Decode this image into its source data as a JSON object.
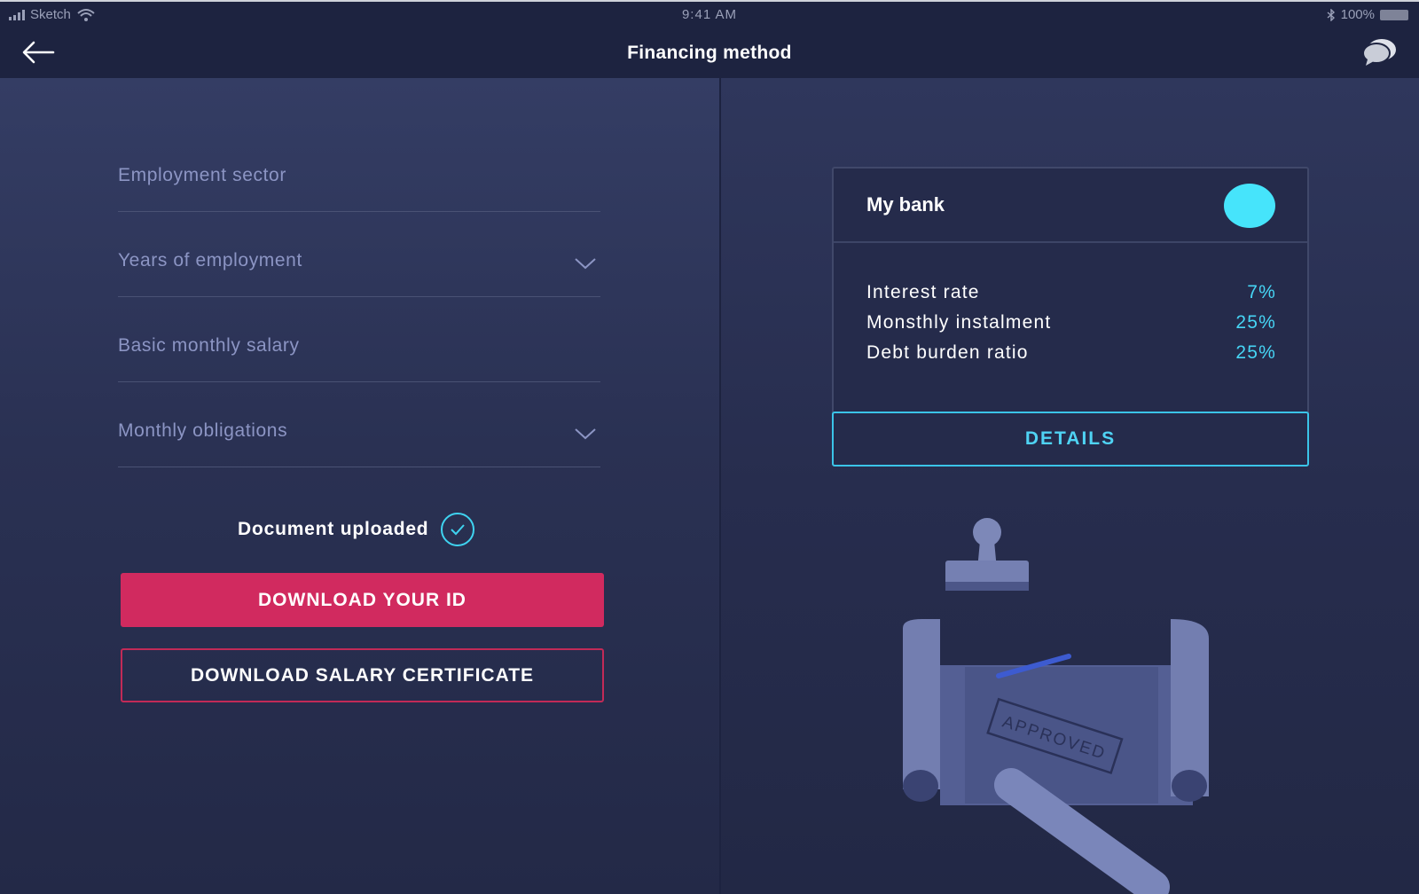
{
  "status_bar": {
    "carrier": "Sketch",
    "time": "9:41 AM",
    "battery": "100%"
  },
  "header": {
    "title": "Financing method"
  },
  "form": {
    "fields": [
      {
        "label": "Employment sector"
      },
      {
        "label": "Years of employment"
      },
      {
        "label": "Basic monthly salary"
      },
      {
        "label": "Monthly obligations"
      }
    ],
    "document_status": "Document uploaded",
    "download_id_label": "DOWNLOAD YOUR ID",
    "download_salary_label": "DOWNLOAD SALARY CERTIFICATE"
  },
  "bank_card": {
    "name": "My bank",
    "metrics": [
      {
        "label": "Interest rate",
        "value": "7%"
      },
      {
        "label": "Monsthly instalment",
        "value": "25%"
      },
      {
        "label": "Debt burden ratio",
        "value": "25%"
      }
    ],
    "details_label": "DETAILS"
  },
  "illustration": {
    "stamp_text": "APPROVED"
  },
  "colors": {
    "accent_cyan": "#46e4fb",
    "primary_button": "#d12a5f",
    "background": "#262c4b"
  }
}
